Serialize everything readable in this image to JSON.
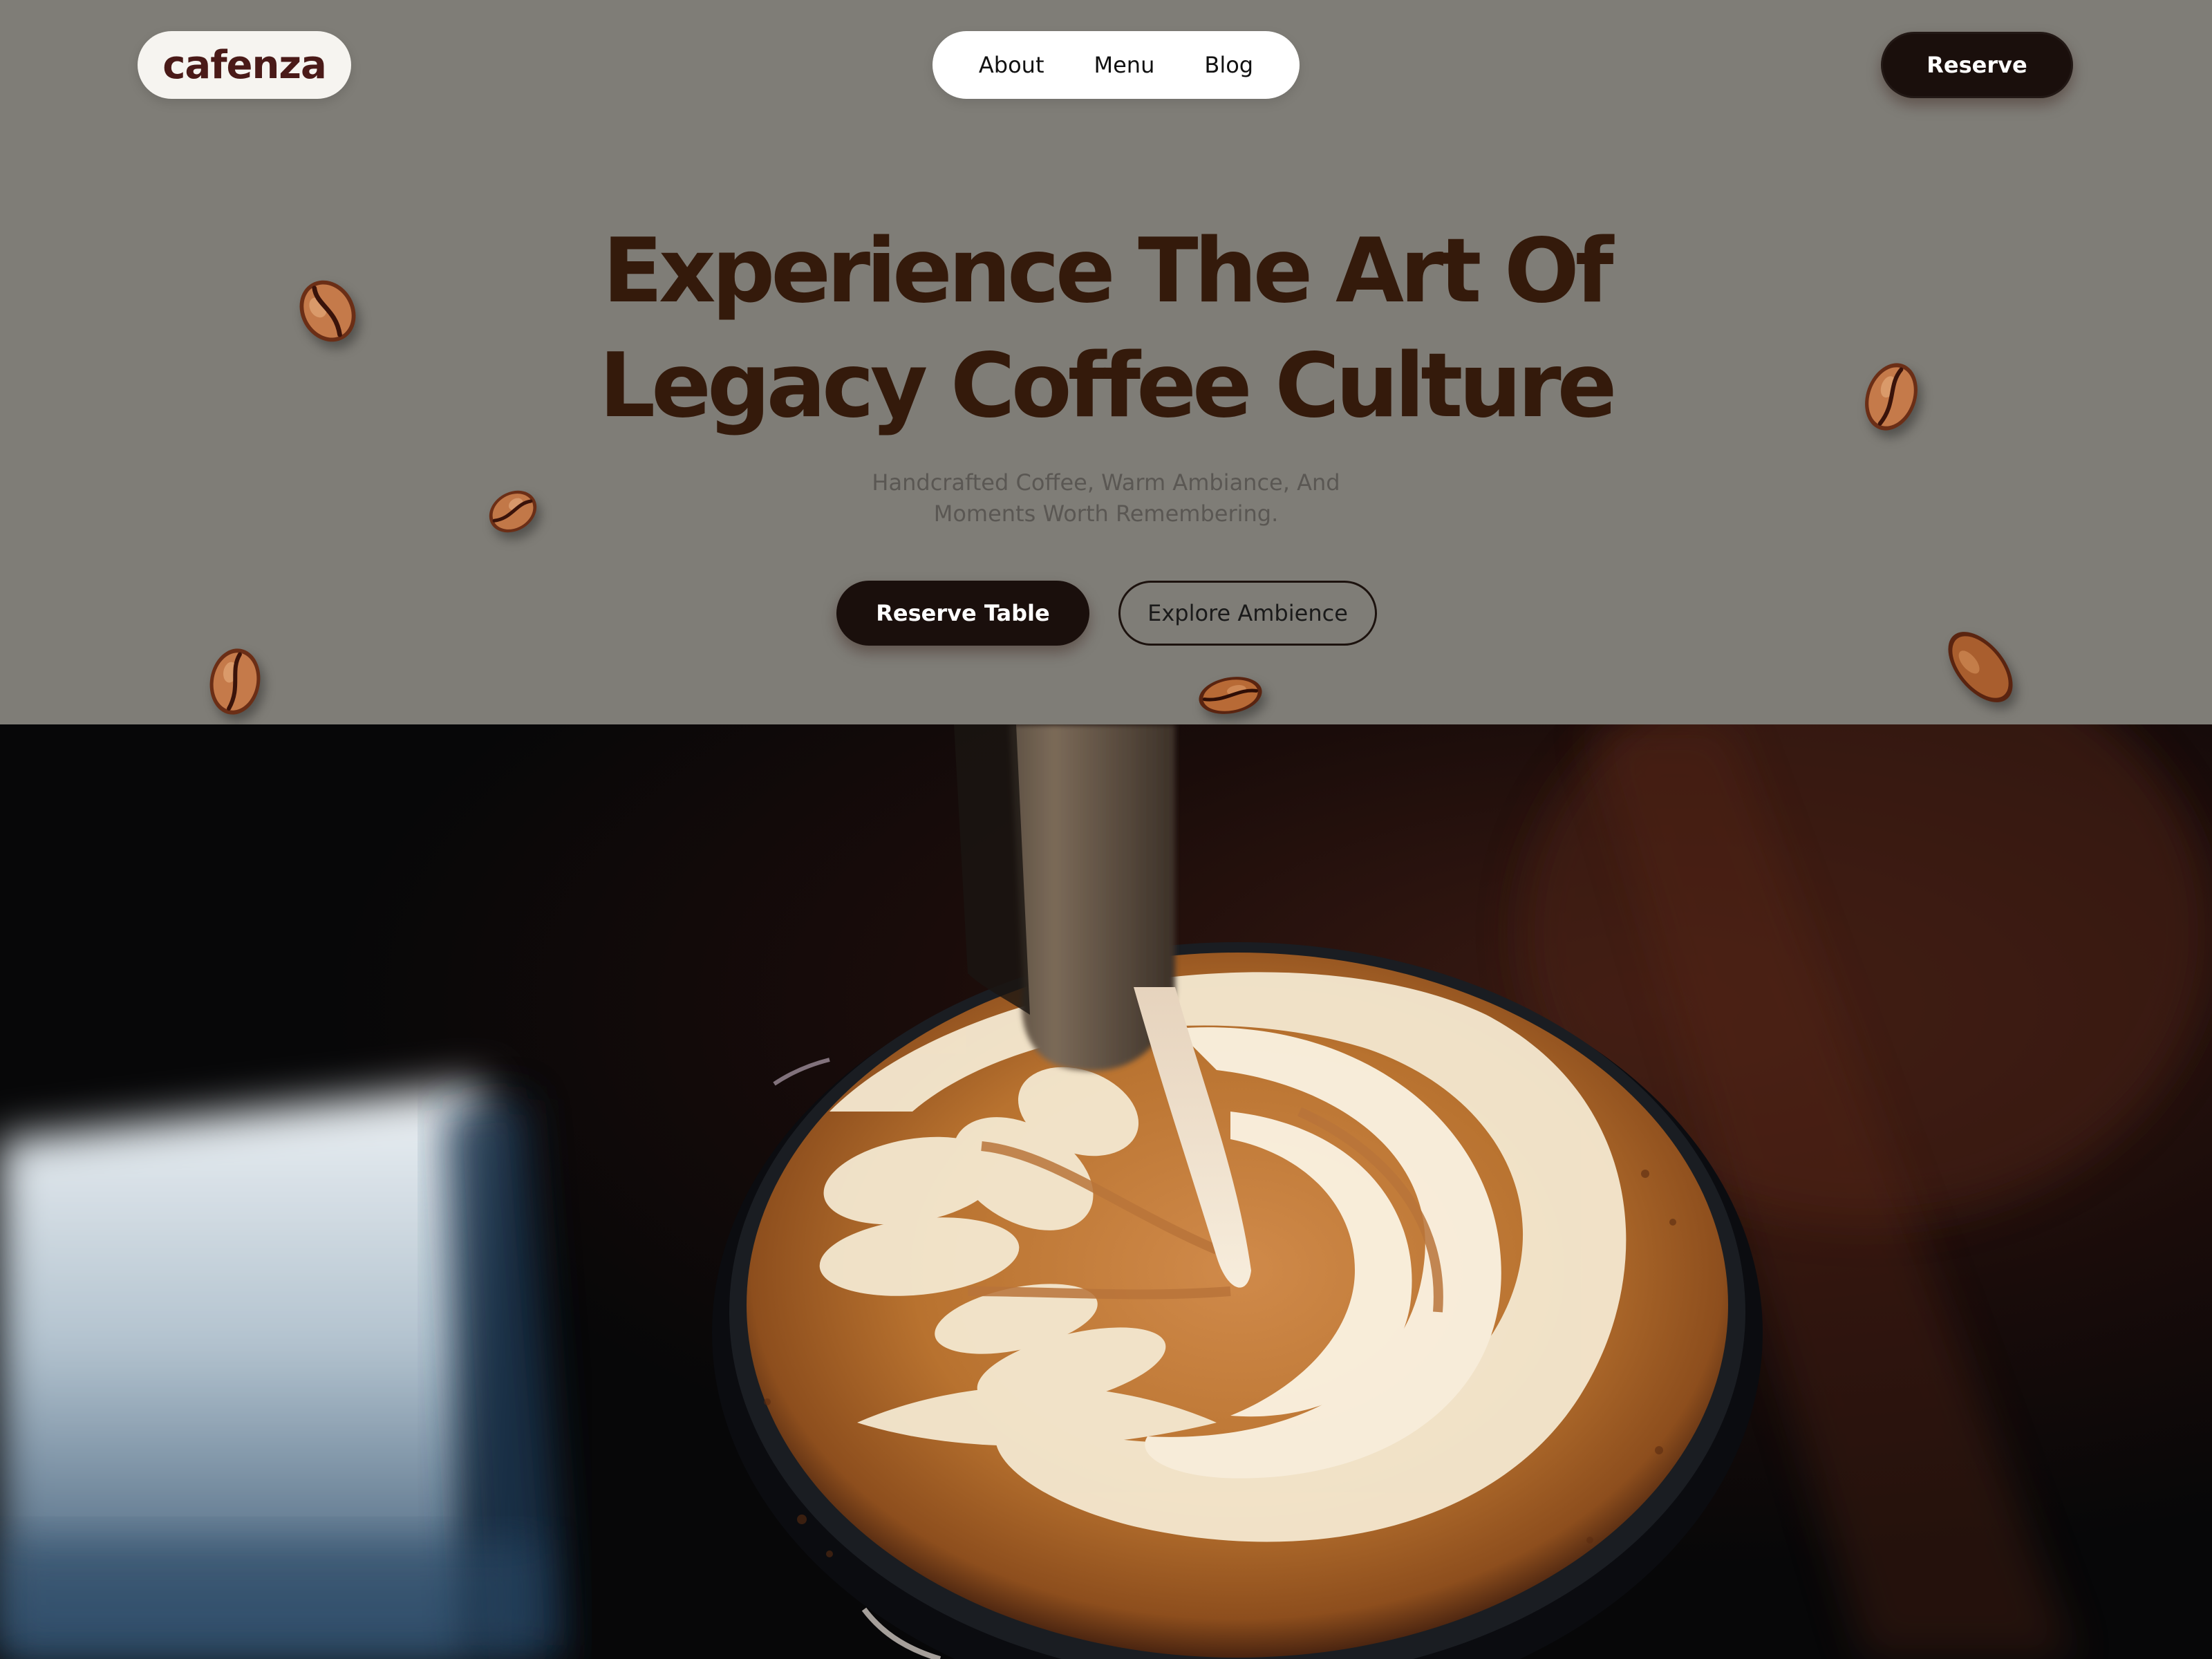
{
  "brand": {
    "logo_text": "cafenza"
  },
  "nav": {
    "links": [
      {
        "label": "About"
      },
      {
        "label": "Menu"
      },
      {
        "label": "Blog"
      }
    ]
  },
  "header": {
    "reserve_label": "Reserve"
  },
  "hero": {
    "headline_line_1": "Experience The Art Of",
    "headline_line_2": "Legacy Coffee Culture",
    "subhead_line_1": "Handcrafted Coffee, Warm Ambiance, And",
    "subhead_line_2": "Moments Worth Remembering.",
    "cta_primary": "Reserve Table",
    "cta_secondary": "Explore Ambience"
  },
  "decor": {
    "bean_icon": "coffee-bean-icon",
    "photo_subject": "latte-art-pour"
  },
  "colors": {
    "hero_background": "#7f7d77",
    "headline": "#341a0b",
    "logo": "#4a1a18",
    "button_dark": "#1a0f0c",
    "crema": "#b9743a",
    "foam": "#f4e8d0"
  }
}
